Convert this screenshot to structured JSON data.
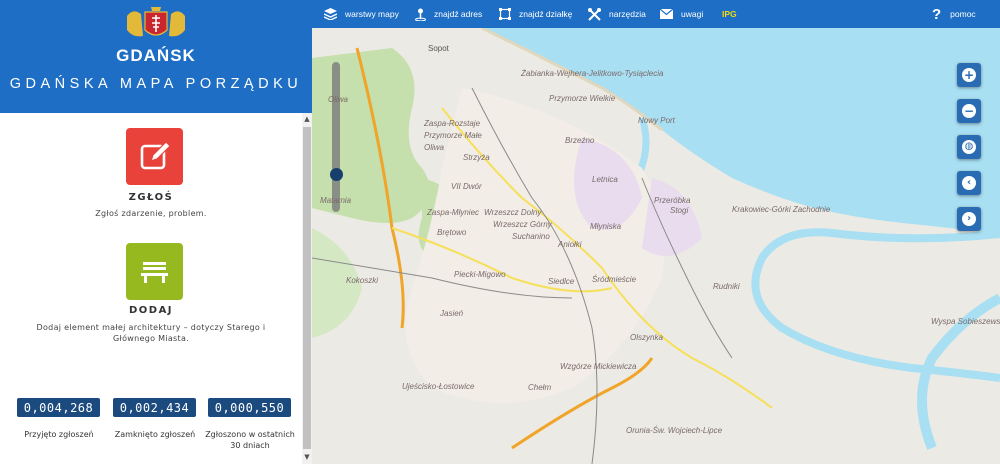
{
  "header": {
    "city_name": "GDAŃSK",
    "app_title": "GDAŃSKA MAPA PORZĄDKU"
  },
  "actions": {
    "report": {
      "label": "ZGŁOŚ",
      "description": "Zgłoś zdarzenie, problem."
    },
    "add": {
      "label": "DODAJ",
      "description": "Dodaj element małej architektury – dotyczy Starego i Głównego Miasta."
    }
  },
  "counters": [
    {
      "value": "0,004,268",
      "label": "Przyjęto zgłoszeń"
    },
    {
      "value": "0,002,434",
      "label": "Zamknięto zgłoszeń"
    },
    {
      "value": "0,000,550",
      "label": "Zgłoszono w ostatnich 30 dniach"
    }
  ],
  "toolbar": {
    "layers": "warstwy mapy",
    "find_address": "znajdź adres",
    "find_parcel": "znajdź działkę",
    "tools": "narzędzia",
    "notes": "uwagi",
    "ipg": "IPG",
    "help": "pomoc"
  },
  "map_labels": {
    "sopot": "Sopot",
    "zabianka": "Żabianka-Wejhera-Jelitkowo-Tysiąclecia",
    "przymorze_wielkie": "Przymorze Wielkie",
    "oliwa_top": "Oliwa",
    "zaspa_rozstaje": "Zaspa-Rozstaje",
    "przymorze_male": "Przymorze Małe",
    "nowy_port": "Nowy Port",
    "oliwa": "Oliwa",
    "brzezno": "Brzeźno",
    "strzyza": "Strzyża",
    "letnica": "Letnica",
    "vii_dwor": "VII Dwór",
    "przerobka": "Przeróbka",
    "stogi": "Stogi",
    "matarnia": "Matarnia",
    "zaspa_mlyniec": "Zaspa-Młyniec",
    "wrzeszcz_dolny": "Wrzeszcz Dolny",
    "wrzeszcz_gorny": "Wrzeszcz Górny",
    "krakowiec": "Krakowiec-Górki Zachodnie",
    "mlyniska": "Młyniska",
    "bretowo": "Brętowo",
    "suchanino": "Suchanino",
    "aniolki": "Aniołki",
    "piecki": "Piecki-Migowo",
    "kokoszki": "Kokoszki",
    "siedlce": "Siedlce",
    "srodmiescie": "Śródmieście",
    "rudniki": "Rudniki",
    "jasien": "Jasień",
    "wyspa": "Wyspa Sobieszewska",
    "olszynka": "Olszynka",
    "wzgorze": "Wzgórze Mickiewicza",
    "ujescisko": "Ujeścisko-Łostowice",
    "chelm": "Chełm",
    "orunia": "Orunia-Św. Wojciech-Lipce"
  },
  "colors": {
    "brand_blue": "#1d6ec4",
    "report_red": "#e8423b",
    "add_green": "#95b91f",
    "counter_navy": "#1b4a7f",
    "sea": "#a9dff2",
    "ipg_yellow": "#f5d90a"
  },
  "icons": {
    "report": "edit-icon",
    "add": "bench-icon",
    "layers": "layers-icon",
    "find_address": "pin-icon",
    "find_parcel": "parcel-icon",
    "tools": "tools-icon",
    "notes": "envelope-icon",
    "help": "question-icon"
  }
}
